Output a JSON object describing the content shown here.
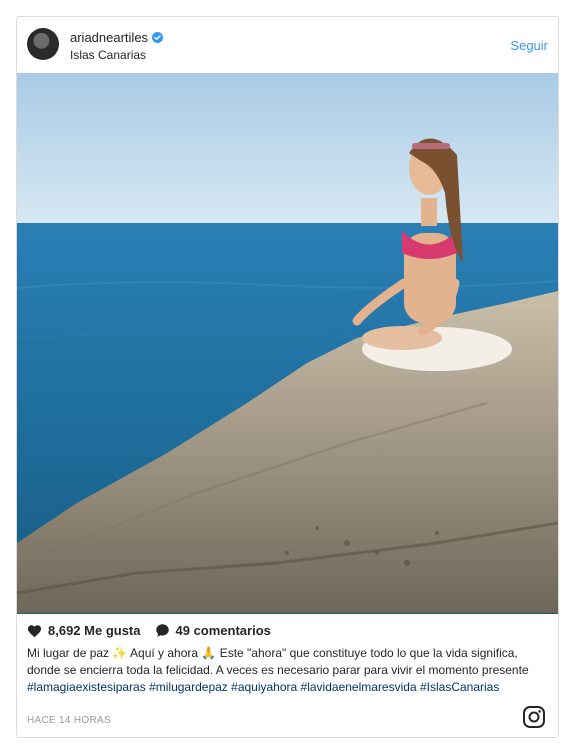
{
  "post": {
    "username": "ariadneartiles",
    "location": "Islas Canarias",
    "follow_label": "Seguir",
    "likes_text": "8,692 Me gusta",
    "comments_text": "49 comentarios",
    "caption": {
      "part1": "Mi lugar de paz",
      "emoji1": "✨",
      "part2": "Aquí y ahora",
      "emoji2": "🙏",
      "part3": "Este \"ahora\" que constituye todo lo que la vida significa, donde se encierra toda la felicidad. A veces es necesario parar para vivir el momento presente",
      "hashtags": [
        "#lamagiaexistesiparas",
        "#milugardepaz",
        "#aquiyahora",
        "#lavidaenelmaresvida",
        "#IslasCanarias"
      ]
    },
    "timestamp": "HACE 14 HORAS"
  },
  "colors": {
    "accent": "#3897f0",
    "hashtag": "#003569",
    "muted": "#999999"
  },
  "icons": [
    "verified-badge-icon",
    "heart-icon",
    "comment-icon",
    "instagram-icon"
  ]
}
